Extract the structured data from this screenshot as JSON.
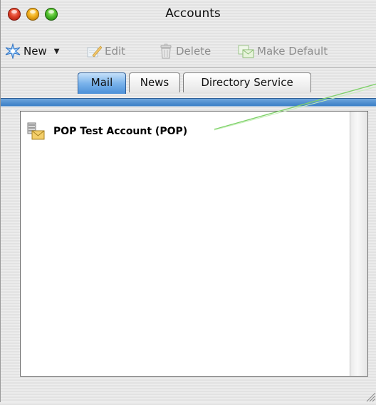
{
  "window": {
    "title": "Accounts"
  },
  "toolbar": {
    "new_label": "New",
    "new_arrow": "▼",
    "edit_label": "Edit",
    "delete_label": "Delete",
    "make_default_label": "Make Default"
  },
  "tabs": [
    {
      "label": "Mail",
      "selected": true
    },
    {
      "label": "News",
      "selected": false
    },
    {
      "label": "Directory Service",
      "selected": false
    }
  ],
  "accounts": [
    {
      "label": "POP Test Account (POP)",
      "icon": "mail-account-icon"
    }
  ],
  "colors": {
    "tab_accent": "#4c90d8",
    "callout_line": "#7fd16a"
  }
}
